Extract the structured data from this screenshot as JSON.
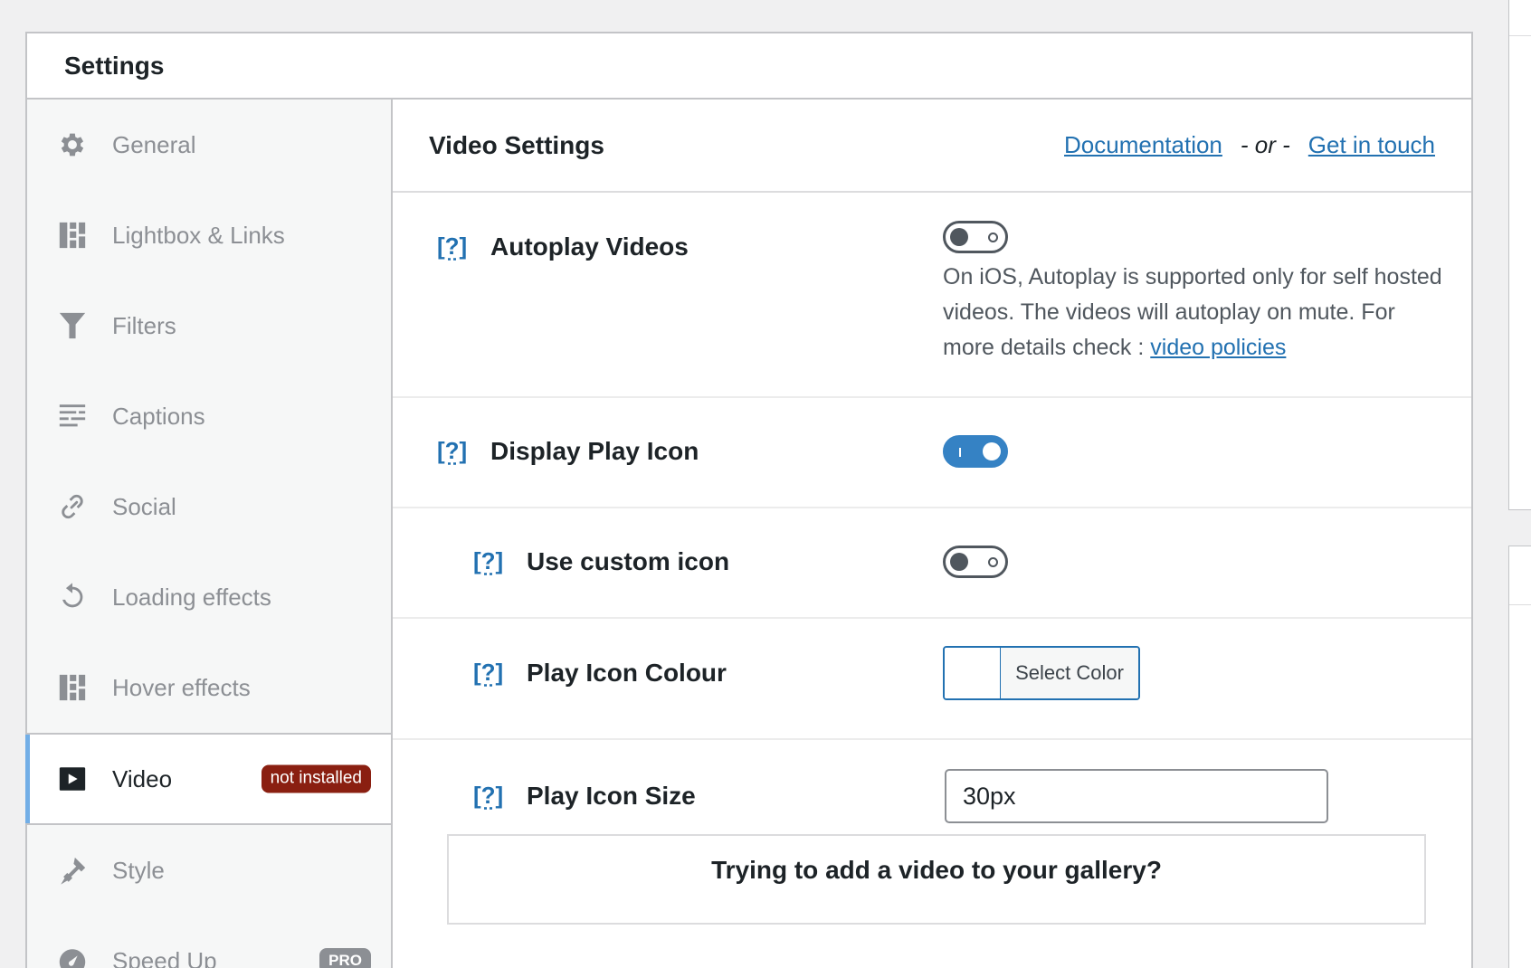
{
  "panel": {
    "title": "Settings"
  },
  "sidebar": {
    "items": [
      {
        "label": "General",
        "icon": "gear-icon"
      },
      {
        "label": "Lightbox & Links",
        "icon": "layout-icon"
      },
      {
        "label": "Filters",
        "icon": "filter-icon"
      },
      {
        "label": "Captions",
        "icon": "text-lines-icon"
      },
      {
        "label": "Social",
        "icon": "link-icon"
      },
      {
        "label": "Loading effects",
        "icon": "refresh-icon"
      },
      {
        "label": "Hover effects",
        "icon": "layout-icon"
      },
      {
        "label": "Video",
        "icon": "video-play-icon",
        "badge": "not installed",
        "active": true
      },
      {
        "label": "Style",
        "icon": "brush-icon"
      },
      {
        "label": "Speed Up",
        "icon": "gauge-icon",
        "badge": "PRO"
      }
    ]
  },
  "content": {
    "title": "Video Settings",
    "links": {
      "documentation": "Documentation",
      "or": "- or -",
      "contact": "Get in touch"
    },
    "help_marker": "[?]",
    "rows": {
      "autoplay": {
        "label": "Autoplay Videos",
        "enabled": false,
        "description": "On iOS, Autoplay is supported only for self hosted videos. The videos will autoplay on mute. For more details check :",
        "description_link": "video policies"
      },
      "display_play_icon": {
        "label": "Display Play Icon",
        "enabled": true
      },
      "use_custom_icon": {
        "label": "Use custom icon",
        "enabled": false
      },
      "play_icon_colour": {
        "label": "Play Icon Colour",
        "button": "Select Color"
      },
      "play_icon_size": {
        "label": "Play Icon Size",
        "value": "30px"
      }
    },
    "notice": {
      "title": "Trying to add a video to your gallery?"
    }
  },
  "colors": {
    "accent": "#2271b1",
    "toggle_on": "#3582c4",
    "badge": "#8a1f11",
    "active_bar": "#72aee6"
  }
}
